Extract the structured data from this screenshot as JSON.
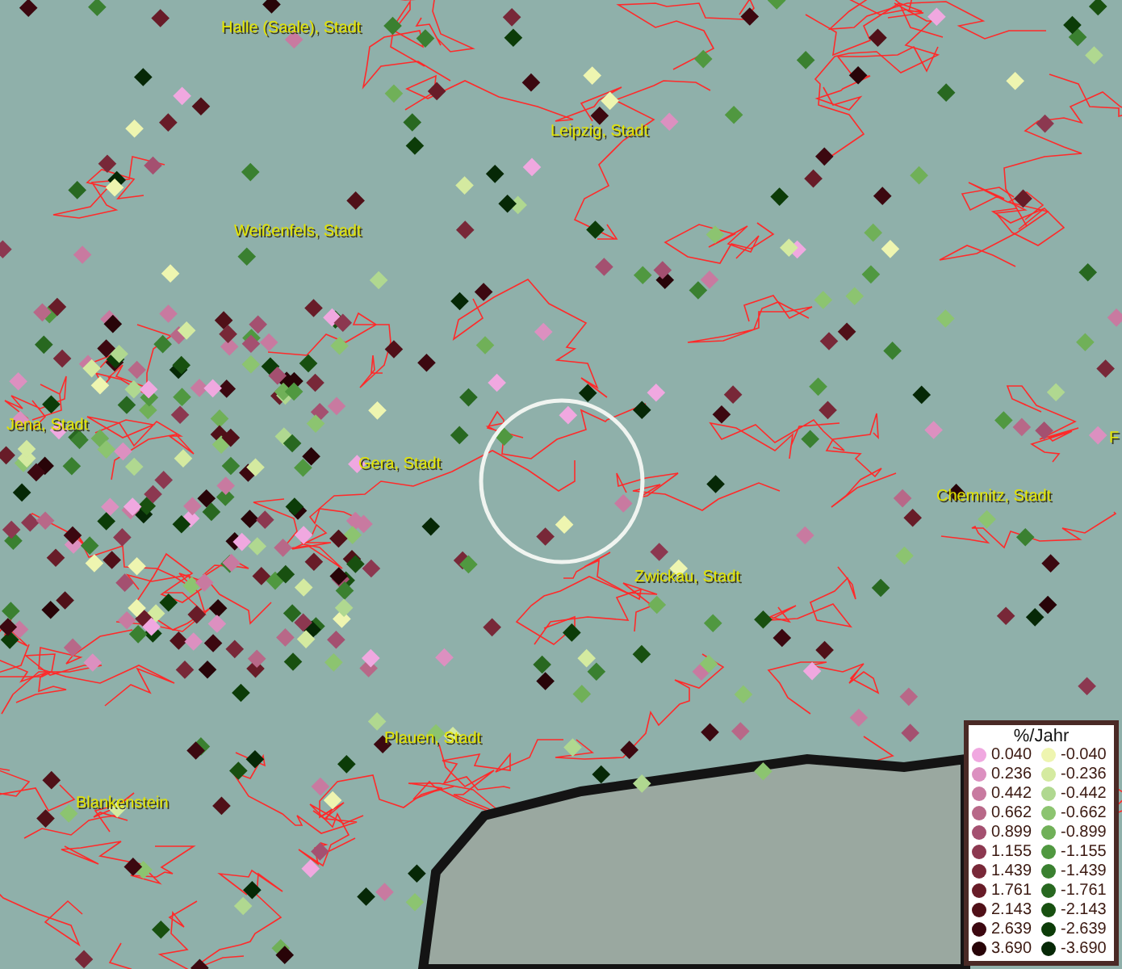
{
  "map": {
    "cities": [
      {
        "name": "Halle (Saale), Stadt"
      },
      {
        "name": "Leipzig, Stadt"
      },
      {
        "name": "Weißenfels, Stadt"
      },
      {
        "name": "Jena, Stadt"
      },
      {
        "name": "Gera, Stadt"
      },
      {
        "name": "Chemnitz, Stadt"
      },
      {
        "name": "Zwickau, Stadt"
      },
      {
        "name": "Plauen, Stadt"
      },
      {
        "name": "Blankenstein"
      },
      {
        "name": "F"
      }
    ]
  },
  "legend": {
    "title": "%/Jahr",
    "rows": [
      {
        "positive": {
          "value": "0.040",
          "color": "#f0a8e0"
        },
        "negative": {
          "value": "-0.040",
          "color": "#eef5b0"
        }
      },
      {
        "positive": {
          "value": "0.236",
          "color": "#dc90c0"
        },
        "negative": {
          "value": "-0.236",
          "color": "#d4eaa0"
        }
      },
      {
        "positive": {
          "value": "0.442",
          "color": "#c87aa0"
        },
        "negative": {
          "value": "-0.442",
          "color": "#b0d890"
        }
      },
      {
        "positive": {
          "value": "0.662",
          "color": "#b86888"
        },
        "negative": {
          "value": "-0.662",
          "color": "#8cc470"
        }
      },
      {
        "positive": {
          "value": "0.899",
          "color": "#a45070"
        },
        "negative": {
          "value": "-0.899",
          "color": "#70b058"
        }
      },
      {
        "positive": {
          "value": "1.155",
          "color": "#8c3850"
        },
        "negative": {
          "value": "-1.155",
          "color": "#509840"
        }
      },
      {
        "positive": {
          "value": "1.439",
          "color": "#782838"
        },
        "negative": {
          "value": "-1.439",
          "color": "#3a8030"
        }
      },
      {
        "positive": {
          "value": "1.761",
          "color": "#681c28"
        },
        "negative": {
          "value": "-1.761",
          "color": "#286820"
        }
      },
      {
        "positive": {
          "value": "2.143",
          "color": "#501018"
        },
        "negative": {
          "value": "-2.143",
          "color": "#185010"
        }
      },
      {
        "positive": {
          "value": "2.639",
          "color": "#3c0810"
        },
        "negative": {
          "value": "-2.639",
          "color": "#0c3c08"
        }
      },
      {
        "positive": {
          "value": "3.690",
          "color": "#280408"
        },
        "negative": {
          "value": "-3.690",
          "color": "#062806"
        }
      }
    ]
  }
}
